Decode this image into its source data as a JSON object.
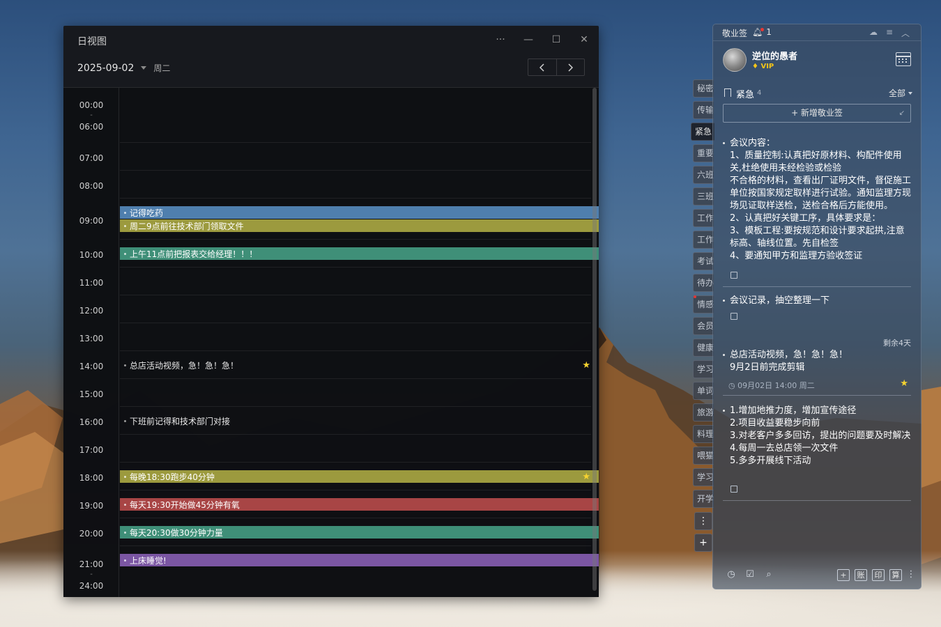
{
  "calendar": {
    "title": "日视图",
    "date": "2025-09-02",
    "weekday": "周二",
    "controls": {
      "more": "···",
      "minimize": "—",
      "maximize": "☐",
      "close": "✕"
    },
    "nav": {
      "prev": "‹",
      "next": "›"
    },
    "time_labels": [
      "00:00",
      "06:00",
      "07:00",
      "08:00",
      "09:00",
      "10:00",
      "11:00",
      "12:00",
      "13:00",
      "14:00",
      "15:00",
      "16:00",
      "17:00",
      "18:00",
      "19:00",
      "20:00",
      "21:00",
      "24:00"
    ],
    "collapsed_marker": "-",
    "events": [
      {
        "title": "记得吃药",
        "color": "#4f7fae",
        "starred": false
      },
      {
        "title": "周二9点前往技术部门领取文件",
        "color": "#9c9a3e",
        "starred": false
      },
      {
        "title": "上午11点前把报表交给经理！！！",
        "color": "#3f8f78",
        "starred": false
      },
      {
        "title": "总店活动视频，急！急！急！",
        "color": "",
        "starred": true
      },
      {
        "title": "下班前记得和技术部门对接",
        "color": "",
        "starred": false
      },
      {
        "title": "每晚18:30跑步40分钟",
        "color": "#9c9a3e",
        "starred": true
      },
      {
        "title": "每天19:30开始做45分钟有氧",
        "color": "#a84545",
        "starred": false
      },
      {
        "title": "每天20:30做30分钟力量",
        "color": "#3f8f78",
        "starred": false
      },
      {
        "title": "上床睡觉!",
        "color": "#7b56a3",
        "starred": false
      }
    ]
  },
  "tabs": [
    "秘密",
    "传输",
    "紧急",
    "重要",
    "六班",
    "三班",
    "工作",
    "工作",
    "考试",
    "待办",
    "情感",
    "会员",
    "健康",
    "学习",
    "单词",
    "旅游",
    "料理",
    "喂猫",
    "学习",
    "开学"
  ],
  "tab_more": "⋮",
  "tab_add": "+",
  "notes": {
    "app_name": "敬业签",
    "bell_count": "1",
    "top_icons": {
      "cloud": "☁",
      "menu": "≡",
      "collapse": "︿"
    },
    "user": {
      "name": "逆位的愚者",
      "badge": "VIP"
    },
    "category": {
      "name": "紧急",
      "count": "4",
      "filter": "全部"
    },
    "add_button": "+ 新增敬业签",
    "add_shortcut": "↙",
    "items": [
      {
        "text": "会议内容：\n1、质量控制:认真把好原材料、构配件使用关,杜绝使用未经检验或检验\n不合格的材料，查看出厂证明文件，督促施工单位按国家规定取样进行试验。通知监理方现场见证取样送检，送检合格后方能使用。\n2、认真把好关键工序，具体要求是：\n3、模板工程:要按规范和设计要求起拱,注意标高、轴线位置。先自检签\n4、要通知甲方和监理方验收签证"
      },
      {
        "text": "会议记录，抽空整理一下"
      },
      {
        "text": "总店活动视频，急！急！急！\n9月2日前完成剪辑",
        "remaining": "剩余4天",
        "meta": "09月02日 14:00 周二"
      },
      {
        "text": "1.增加地推力度，增加宣传途径\n2.项目收益要稳步向前\n3.对老客户多多回访，提出的问题要及时解决\n4.每周一去总店领一次文件\n5.多多开展线下活动"
      }
    ],
    "bottom": {
      "clock": "◷",
      "check": "☑",
      "search": "⌕",
      "add": "+",
      "account": "账",
      "print": "印",
      "calc": "算",
      "more": "⋮"
    }
  },
  "colors": {
    "star": "#f5d230",
    "accent_vip": "#f5c518"
  }
}
